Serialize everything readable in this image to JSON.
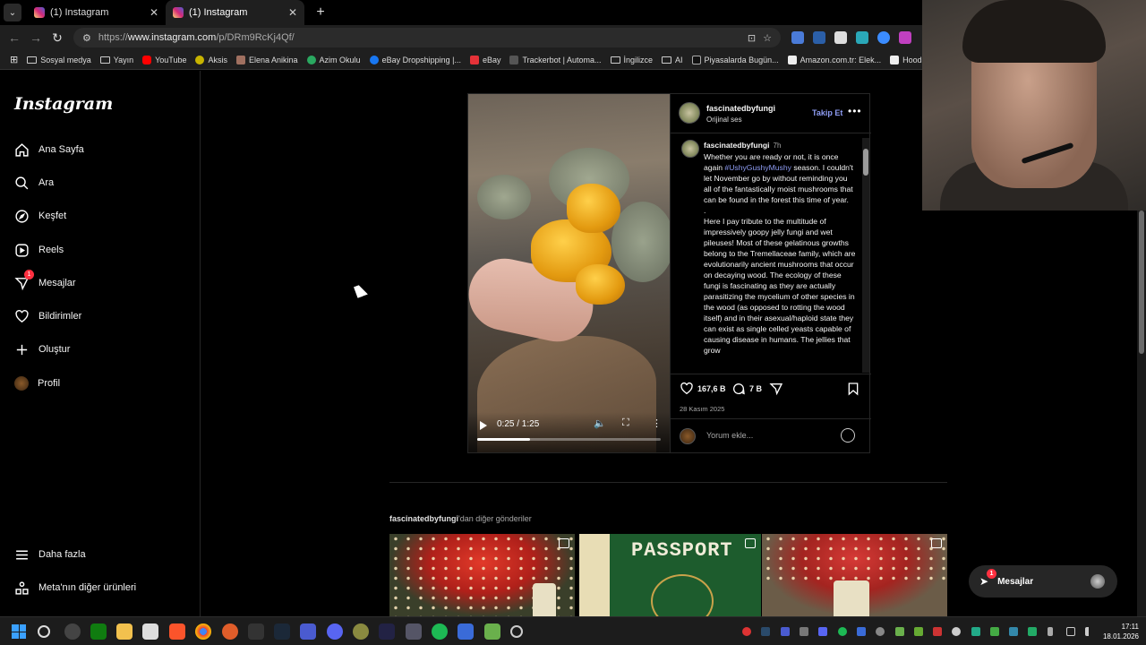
{
  "browser": {
    "tabs": [
      {
        "title": "(1) Instagram",
        "active": false
      },
      {
        "title": "(1) Instagram",
        "active": true
      }
    ],
    "url_prefix": "https://",
    "url_host": "www.instagram.com",
    "url_path": "/p/DRm9RcKj4Qf/",
    "bookmarks": [
      {
        "label": "Sosyal medya",
        "icon": "folder-icon"
      },
      {
        "label": "Yayın",
        "icon": "folder-icon"
      },
      {
        "label": "YouTube",
        "icon": "youtube-icon",
        "color": "#ff0000"
      },
      {
        "label": "Aksis",
        "icon": "aksis-icon",
        "color": "#c8b400"
      },
      {
        "label": "Elena Anikina",
        "icon": "avatar-icon",
        "color": "#a07060"
      },
      {
        "label": "Azim Okulu",
        "icon": "azim-icon",
        "color": "#2aa860"
      },
      {
        "label": "eBay Dropshipping |...",
        "icon": "facebook-icon",
        "color": "#1877f2"
      },
      {
        "label": "eBay",
        "icon": "ebay-icon",
        "color": "#e53238"
      },
      {
        "label": "Trackerbot | Automa...",
        "icon": "trackerbot-icon",
        "color": "#555555"
      },
      {
        "label": "İngilizce",
        "icon": "folder-icon"
      },
      {
        "label": "AI",
        "icon": "folder-icon"
      },
      {
        "label": "Piyasalarda Bugün...",
        "icon": "yt-icon",
        "color": "#111111"
      },
      {
        "label": "Amazon.com.tr: Elek...",
        "icon": "amazon-icon",
        "color": "#eeeeee"
      },
      {
        "label": "Hoodie Modelleri |",
        "icon": "hoodie-icon",
        "color": "#eeeeee"
      }
    ]
  },
  "sidebar": {
    "logo": "Instagram",
    "items": [
      {
        "label": "Ana Sayfa",
        "icon": "home-icon"
      },
      {
        "label": "Ara",
        "icon": "search-icon"
      },
      {
        "label": "Keşfet",
        "icon": "compass-icon"
      },
      {
        "label": "Reels",
        "icon": "reels-icon"
      },
      {
        "label": "Mesajlar",
        "icon": "messenger-icon",
        "badge": "1"
      },
      {
        "label": "Bildirimler",
        "icon": "heart-icon"
      },
      {
        "label": "Oluştur",
        "icon": "plus-icon"
      },
      {
        "label": "Profil",
        "icon": "avatar"
      }
    ],
    "bottom_items": [
      {
        "label": "Daha fazla",
        "icon": "menu-icon"
      },
      {
        "label": "Meta'nın diğer ürünleri",
        "icon": "grid-icon"
      }
    ]
  },
  "post": {
    "username": "fascinatedbyfungi",
    "audio": "Orijinal ses",
    "follow_label": "Takip Et",
    "caption_user": "fascinatedbyfungi",
    "caption_time": "7h",
    "caption_part1": "Whether you are ready or not, it is once again ",
    "hashtag": "#UshyGushyMushy",
    "caption_part2": " season. I couldn't let November go by without reminding you all of the fantastically moist mushrooms that can be found in the forest this time of year.",
    "caption_dot": ".",
    "caption_part3": "Here I pay tribute to the multitude of impressively goopy jelly fungi and wet pileuses! Most of these gelatinous growths belong to the Tremellaceae family, which are evolutionarily ancient mushrooms that occur on decaying wood. The ecology of these fungi is fascinating as they are actually parasitizing the mycelium of other species in the wood (as opposed to rotting the wood itself) and in their asexual/haploid state they can exist as single celled yeasts capable of causing disease in humans. The jellies that grow",
    "likes": "167,6 B",
    "comments": "7 B",
    "date": "28 Kasım 2025",
    "comment_placeholder": "Yorum ekle...",
    "video": {
      "time": "0:25 / 1:25",
      "progress": 0.29
    }
  },
  "more_posts": {
    "user": "fascinatedbyfungi",
    "suffix": "'dan diğer gönderiler",
    "passport_text": "PASSPORT"
  },
  "messages_float": {
    "label": "Mesajlar",
    "badge": "1"
  },
  "taskbar": {
    "time": "17:11",
    "date": "18.01.2026"
  }
}
